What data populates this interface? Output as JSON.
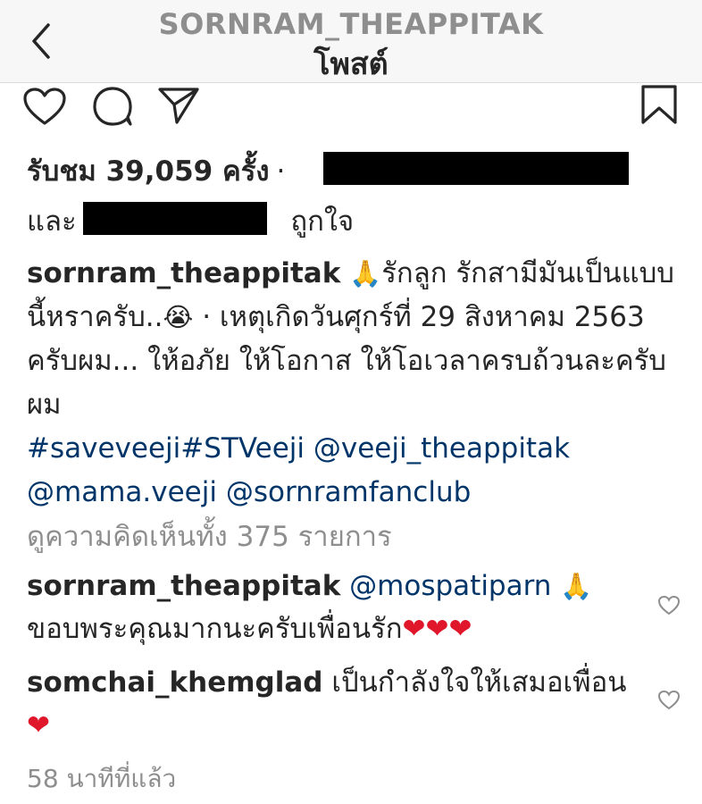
{
  "header": {
    "username": "SORNRAM_THEAPPITAK",
    "title": "โพสต์"
  },
  "actions": {
    "like_icon": "heart-outline-icon",
    "comment_icon": "comment-bubble-icon",
    "share_icon": "paper-plane-icon",
    "save_icon": "bookmark-icon"
  },
  "stats": {
    "views": "รับชม 39,059 ครั้ง",
    "separator": "·",
    "and_label": "และ",
    "liked_label": "ถูกใจ"
  },
  "caption": {
    "username": "sornram_theappitak",
    "emoji_pray": "🙏",
    "text_1": "รักลูก รักสามีมันเป็นแบบนี้หราครับ..",
    "emoji_cry": "😭",
    "text_2": " · เหตุเกิดวันศุกร์ที่ 29 สิงหาคม 2563  ครับผม... ให้อภัย ให้โอกาส ให้โอเวลาครบถ้วนละครับผม",
    "hashtags": "#saveveeji#STVeeji",
    "mention_1": "@veeji_theappitak",
    "mention_2": "@mama.veeji",
    "mention_3": "@sornramfanclub"
  },
  "view_all_comments": "ดูความคิดเห็นทั้ง 375 รายการ",
  "comments": [
    {
      "username": "sornram_theappitak",
      "mention": "@mospatiparn",
      "emoji": "🙏",
      "text": "ขอบพระคุณมากนะครับเพื่อนรัก",
      "hearts": "❤❤❤"
    },
    {
      "username": "somchai_khemglad",
      "text": "เป็นกำลังใจให้เสมอเพื่อน",
      "hearts": "❤"
    }
  ],
  "timestamp": "58 นาทีที่แล้ว",
  "colors": {
    "link": "#003569",
    "muted": "#8e8e8e",
    "text": "#262626",
    "heart_red": "#e0162b"
  }
}
